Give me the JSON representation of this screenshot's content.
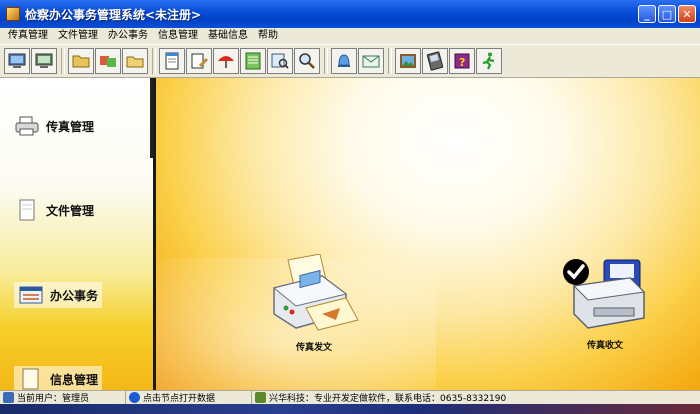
{
  "window": {
    "title": "检察办公事务管理系统<未注册>",
    "buttons": {
      "minimize": "_",
      "maximize": "□",
      "close": "✕"
    }
  },
  "menu": [
    "传真管理",
    "文件管理",
    "办公事务",
    "信息管理",
    "基础信息",
    "帮助"
  ],
  "toolbar": {
    "icons": [
      "monitor-icon",
      "monitor-screen-icon",
      "folder-icon",
      "folder-transfer-icon",
      "folder-open-icon",
      "notepad-icon",
      "document-edit-icon",
      "umbrella-icon",
      "ledger-icon",
      "search-document-icon",
      "magnifier-icon",
      "bell-icon",
      "envelope-icon",
      "picture-icon",
      "phone-book-icon",
      "help-book-icon",
      "exit-runner-icon"
    ]
  },
  "nav": {
    "items": [
      {
        "label": "传真管理",
        "icon": "fax-icon"
      },
      {
        "label": "文件管理",
        "icon": "file-icon"
      },
      {
        "label": "办公事务",
        "icon": "office-icon"
      },
      {
        "label": "信息管理",
        "icon": "info-icon"
      }
    ]
  },
  "main": {
    "items": [
      {
        "label": "传真发文",
        "icon": "fax-send-icon"
      },
      {
        "label": "传真收文",
        "icon": "fax-receive-icon"
      }
    ]
  },
  "status": {
    "user": "当前用户：管理员",
    "hint": "点击节点打开数据",
    "company": "兴华科技：专业开发定做软件，联系电话：0635-8332190"
  },
  "colors": {
    "title_bar": "#0a4fd8",
    "chrome": "#ece9d8",
    "gradient_orange": "#f5ac14"
  }
}
